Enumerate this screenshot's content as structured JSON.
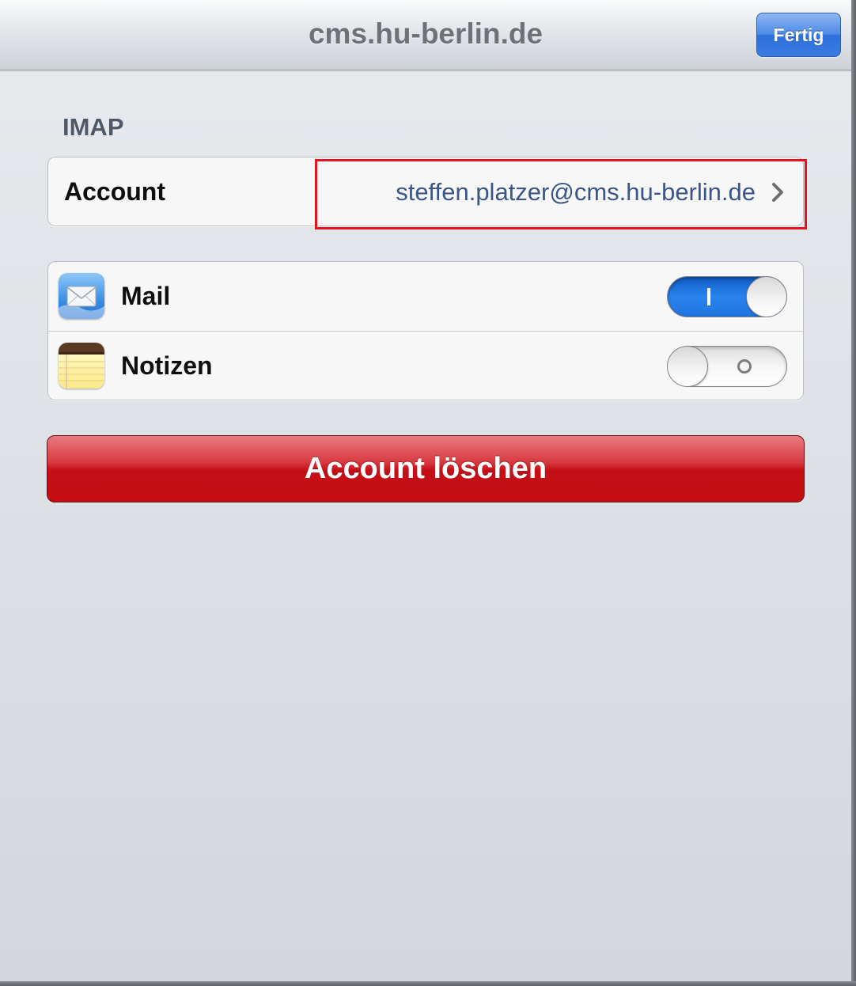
{
  "navbar": {
    "title": "cms.hu-berlin.de",
    "done_label": "Fertig"
  },
  "section": {
    "header": "IMAP"
  },
  "account_row": {
    "label": "Account",
    "value": "steffen.platzer@cms.hu-berlin.de",
    "chevron_icon": "chevron-right-icon",
    "highlight_color": "#e5131d"
  },
  "services": [
    {
      "label": "Mail",
      "icon": "mail-app-icon",
      "enabled": true
    },
    {
      "label": "Notizen",
      "icon": "notes-app-icon",
      "enabled": false
    }
  ],
  "delete_button": {
    "label": "Account löschen",
    "color": "#c50f16"
  },
  "colors": {
    "toggle_on": "#1f74e0",
    "done_button": "#3b7ce2"
  }
}
